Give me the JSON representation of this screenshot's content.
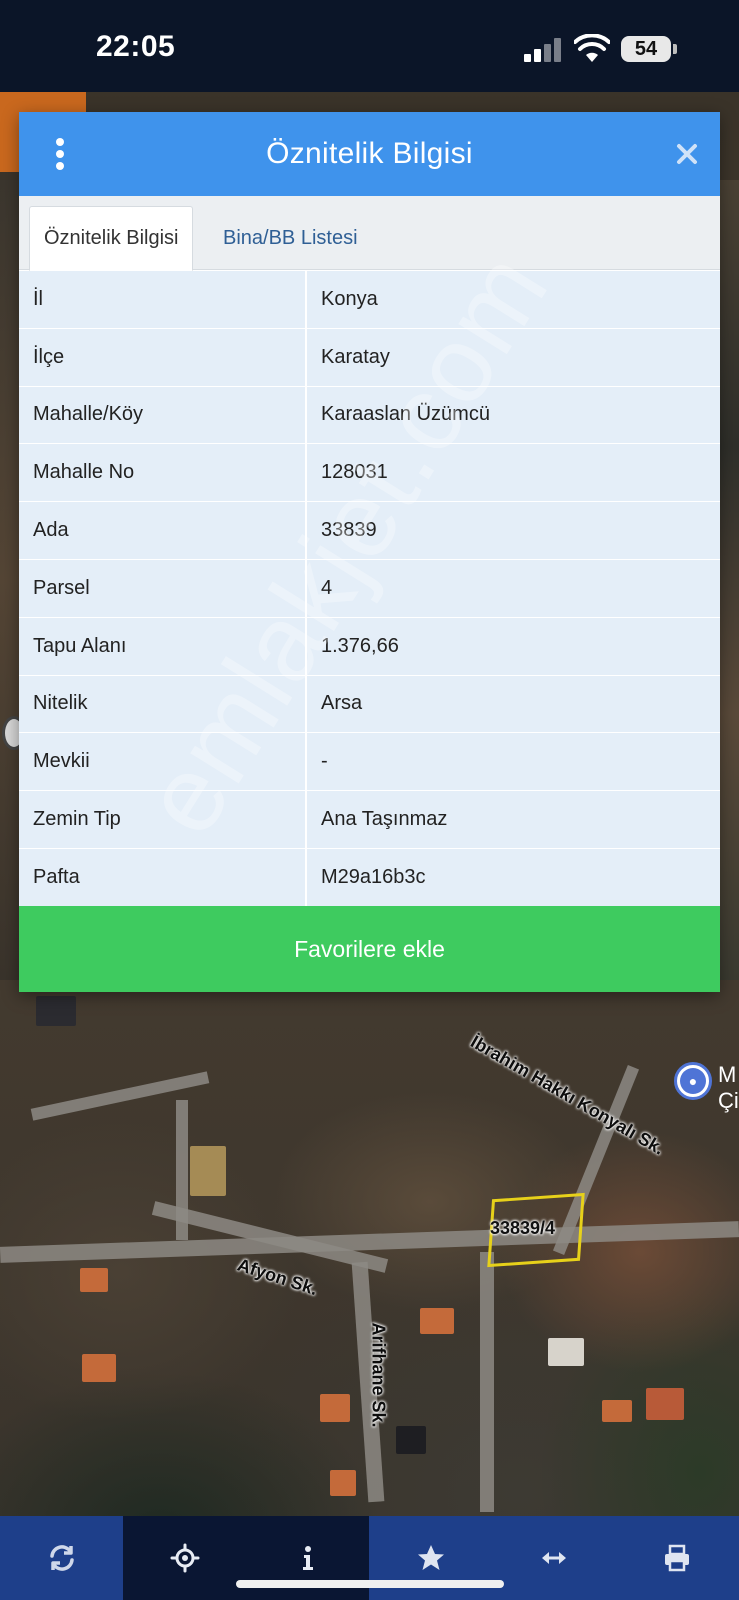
{
  "status_bar": {
    "time": "22:05",
    "battery": "54"
  },
  "dialog": {
    "title": "Öznitelik Bilgisi",
    "menu_icon": "more-vertical-icon",
    "close_icon": "close-icon",
    "tabs": [
      {
        "label": "Öznitelik Bilgisi",
        "active": true
      },
      {
        "label": "Bina/BB Listesi",
        "active": false
      }
    ],
    "rows": [
      {
        "key": "İl",
        "value": "Konya"
      },
      {
        "key": "İlçe",
        "value": "Karatay"
      },
      {
        "key": "Mahalle/Köy",
        "value": "Karaaslan Üzümcü"
      },
      {
        "key": "Mahalle No",
        "value": "128031"
      },
      {
        "key": "Ada",
        "value": "33839"
      },
      {
        "key": "Parsel",
        "value": "4"
      },
      {
        "key": "Tapu Alanı",
        "value": "1.376,66"
      },
      {
        "key": "Nitelik",
        "value": "Arsa"
      },
      {
        "key": "Mevkii",
        "value": "-"
      },
      {
        "key": "Zemin Tip",
        "value": "Ana Taşınmaz"
      },
      {
        "key": "Pafta",
        "value": "M29a16b3c"
      }
    ],
    "favorite_button": "Favorilere ekle"
  },
  "map": {
    "road_labels": {
      "ibrahim": "İbrahim Hakkı Konyalı Sk.",
      "afyon": "Afyon Sk.",
      "arifhane": "Arifhane Sk."
    },
    "parcel_label": "33839/4",
    "partial_label": "M\nÇi",
    "pin_icon": "lock-pin-icon"
  },
  "watermark": "emlakjet.com",
  "toolbar": {
    "items": [
      {
        "icon": "refresh-icon",
        "active": false
      },
      {
        "icon": "locate-icon",
        "active": true
      },
      {
        "icon": "info-icon",
        "active": true
      },
      {
        "icon": "star-icon",
        "active": false
      },
      {
        "icon": "measure-icon",
        "active": false
      },
      {
        "icon": "print-icon",
        "active": false
      }
    ]
  },
  "colors": {
    "header": "#3f93ec",
    "favorite": "#3ecb5f",
    "toolbar": "#1e3f8a",
    "toolbar_active": "#0a1633",
    "row_bg": "#e4eef8"
  }
}
